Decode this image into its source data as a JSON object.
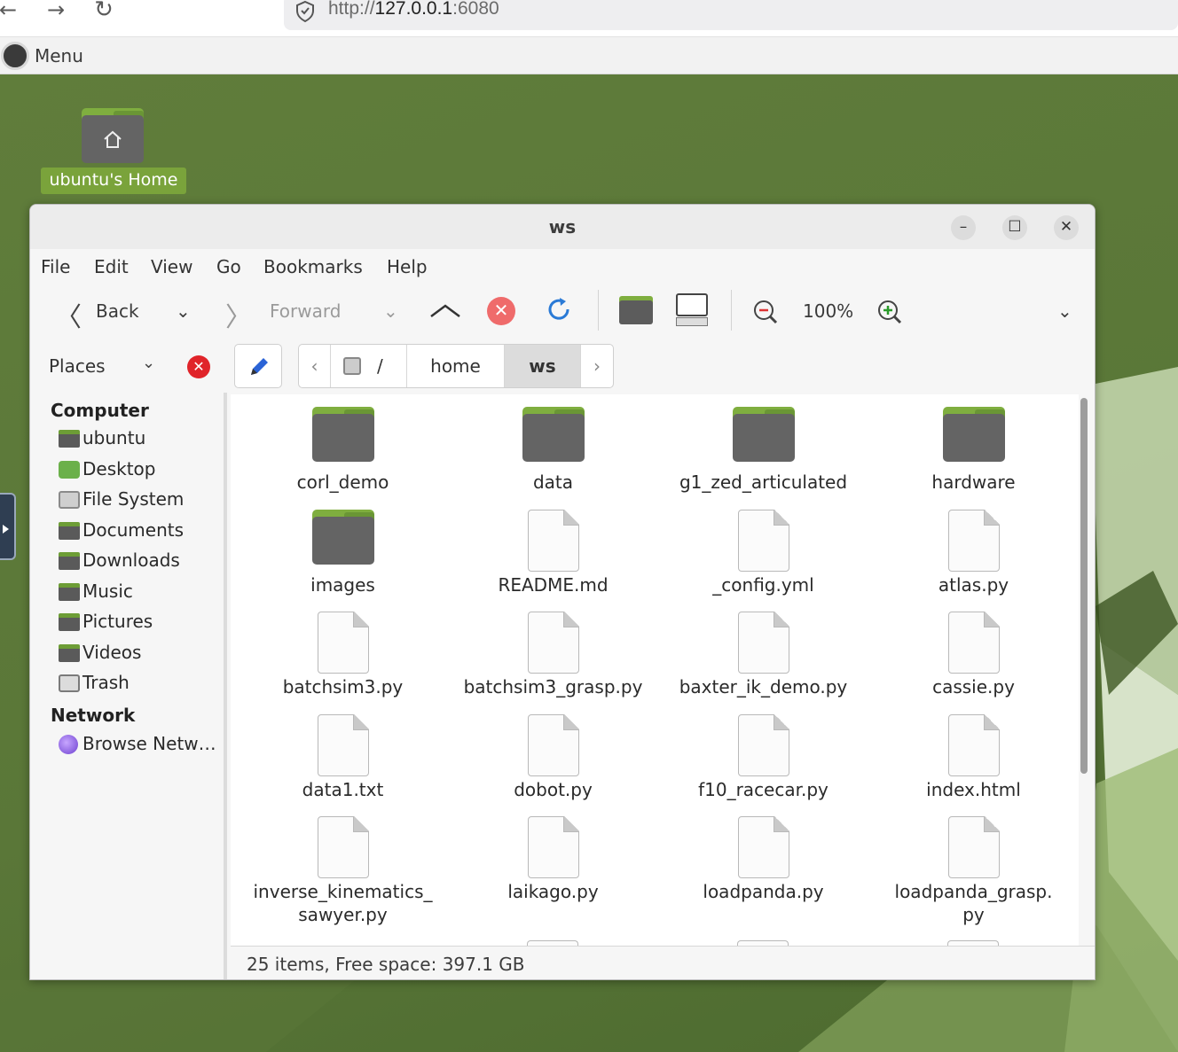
{
  "browser": {
    "back_icon": "arrow-left-icon",
    "forward_icon": "arrow-right-icon",
    "reload_icon": "reload-icon",
    "url_scheme": "http://",
    "url_host": "127.0.0.1",
    "url_port": ":6080"
  },
  "panel": {
    "menu_label": "Menu"
  },
  "desktop": {
    "home_icon_label": "ubuntu's Home"
  },
  "window": {
    "title": "ws",
    "menus": [
      "File",
      "Edit",
      "View",
      "Go",
      "Bookmarks",
      "Help"
    ],
    "toolbar": {
      "back_label": "Back",
      "forward_label": "Forward",
      "zoom": "100%"
    },
    "places_label": "Places",
    "breadcrumb": [
      "/",
      "home",
      "ws"
    ],
    "sidebar": {
      "computer_header": "Computer",
      "computer_items": [
        {
          "label": "ubuntu",
          "icon": "folder-icon"
        },
        {
          "label": "Desktop",
          "icon": "desktop-icon"
        },
        {
          "label": "File System",
          "icon": "drive-icon"
        },
        {
          "label": "Documents",
          "icon": "folder-icon"
        },
        {
          "label": "Downloads",
          "icon": "folder-icon"
        },
        {
          "label": "Music",
          "icon": "folder-icon"
        },
        {
          "label": "Pictures",
          "icon": "folder-icon"
        },
        {
          "label": "Videos",
          "icon": "folder-icon"
        },
        {
          "label": "Trash",
          "icon": "trash-icon"
        }
      ],
      "network_header": "Network",
      "network_items": [
        {
          "label": "Browse Netw…",
          "icon": "network-icon"
        }
      ]
    },
    "files": [
      {
        "name": "corl_demo",
        "type": "folder"
      },
      {
        "name": "data",
        "type": "folder"
      },
      {
        "name": "g1_zed_articulated",
        "type": "folder"
      },
      {
        "name": "hardware",
        "type": "folder"
      },
      {
        "name": "images",
        "type": "folder"
      },
      {
        "name": "README.md",
        "type": "file"
      },
      {
        "name": "_config.yml",
        "type": "file"
      },
      {
        "name": "atlas.py",
        "type": "file"
      },
      {
        "name": "batchsim3.py",
        "type": "file"
      },
      {
        "name": "batchsim3_grasp.py",
        "type": "file"
      },
      {
        "name": "baxter_ik_demo.py",
        "type": "file"
      },
      {
        "name": "cassie.py",
        "type": "file"
      },
      {
        "name": "data1.txt",
        "type": "file"
      },
      {
        "name": "dobot.py",
        "type": "file"
      },
      {
        "name": "f10_racecar.py",
        "type": "file"
      },
      {
        "name": "index.html",
        "type": "file"
      },
      {
        "name": "inverse_kinematics_\nsawyer.py",
        "type": "file"
      },
      {
        "name": "laikago.py",
        "type": "file"
      },
      {
        "name": "loadpanda.py",
        "type": "file"
      },
      {
        "name": "loadpanda_grasp.\npy",
        "type": "file"
      }
    ],
    "status": "25 items, Free space: 397.1 GB"
  },
  "colors": {
    "folder_tab": "#7fae3f",
    "folder_body": "#646464",
    "desktop_bg": "#5f7d3e",
    "accent_label": "#7aa33b"
  }
}
